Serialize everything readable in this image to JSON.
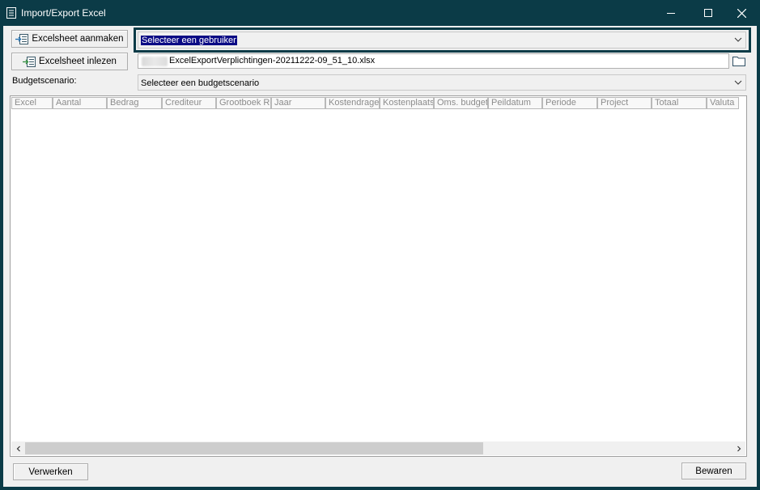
{
  "window": {
    "title": "Import/Export Excel",
    "icon": "spreadsheet-form-icon",
    "controls": [
      "minimize-icon",
      "maximize-icon",
      "close-icon"
    ]
  },
  "toolbar": {
    "create_label": "Excelsheet aanmaken",
    "read_label": "Excelsheet inlezen"
  },
  "user_select": {
    "value": "Selecteer een gebruiker"
  },
  "file": {
    "path": "ExcelExportVerplichtingen-20211222-09_51_10.xlsx"
  },
  "budget": {
    "label": "Budgetscenario:",
    "value": "Selecteer een budgetscenario"
  },
  "grid": {
    "columns": [
      "Excel",
      "Aantal",
      "Bedrag",
      "Crediteur",
      "Grootboek Re",
      "Jaar",
      "Kostendrage",
      "Kostenplaats",
      "Oms. budget",
      "Peildatum",
      "Periode",
      "Project",
      "Totaal",
      "Valuta"
    ],
    "rows": []
  },
  "footer": {
    "process_label": "Verwerken",
    "save_label": "Bewaren"
  },
  "colors": {
    "titlebar": "#0b3b47",
    "client": "#f0f0f0",
    "selection": "#0a0a84"
  }
}
